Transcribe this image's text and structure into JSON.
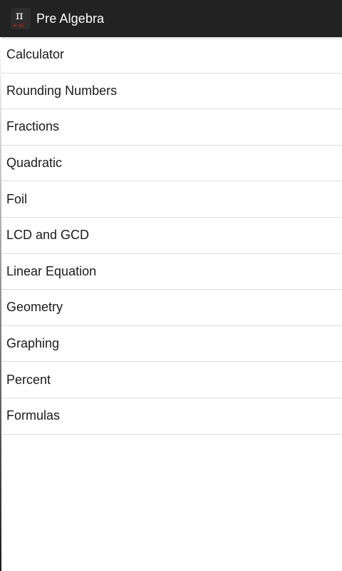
{
  "action_bar": {
    "title": "Pre Algebra",
    "icon": "pi-app-icon"
  },
  "menu": {
    "items": [
      {
        "label": "Calculator"
      },
      {
        "label": "Rounding Numbers"
      },
      {
        "label": "Fractions"
      },
      {
        "label": "Quadratic"
      },
      {
        "label": "Foil"
      },
      {
        "label": "LCD and GCD"
      },
      {
        "label": "Linear Equation"
      },
      {
        "label": "Geometry"
      },
      {
        "label": "Graphing"
      },
      {
        "label": "Percent"
      },
      {
        "label": "Formulas"
      }
    ]
  },
  "colors": {
    "action_bar_bg": "#222222",
    "title_text": "#ffffff",
    "list_text": "#1a1a1a",
    "divider": "#dddddd",
    "icon_accent": "#e02020"
  }
}
